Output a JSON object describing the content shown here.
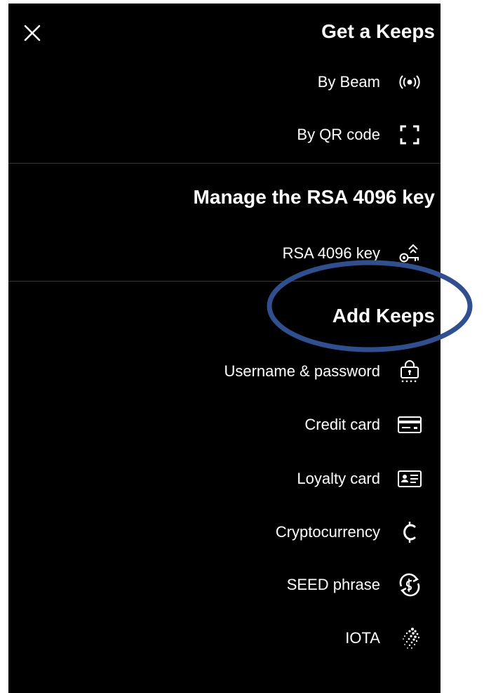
{
  "menu": {
    "close_icon": "close-icon",
    "sections": [
      {
        "title": "Get a Keeps",
        "items": [
          {
            "label": "By Beam",
            "icon": "beam-icon"
          },
          {
            "label": "By QR code",
            "icon": "qr-scan-icon"
          }
        ]
      },
      {
        "title": "Manage the RSA 4096 key",
        "items": [
          {
            "label": "RSA 4096 key",
            "icon": "key-icon"
          }
        ]
      },
      {
        "title": "Add Keeps",
        "items": [
          {
            "label": "Username & password",
            "icon": "password-icon"
          },
          {
            "label": "Credit card",
            "icon": "credit-card-icon"
          },
          {
            "label": "Loyalty card",
            "icon": "loyalty-card-icon"
          },
          {
            "label": "Cryptocurrency",
            "icon": "cryptocurrency-icon"
          },
          {
            "label": "SEED phrase",
            "icon": "seed-phrase-icon"
          },
          {
            "label": "IOTA",
            "icon": "iota-icon"
          }
        ]
      }
    ]
  },
  "colors": {
    "background": "#000000",
    "text": "#ffffff",
    "divider": "#3a3a3a",
    "annotation": "#2f4f8f"
  }
}
